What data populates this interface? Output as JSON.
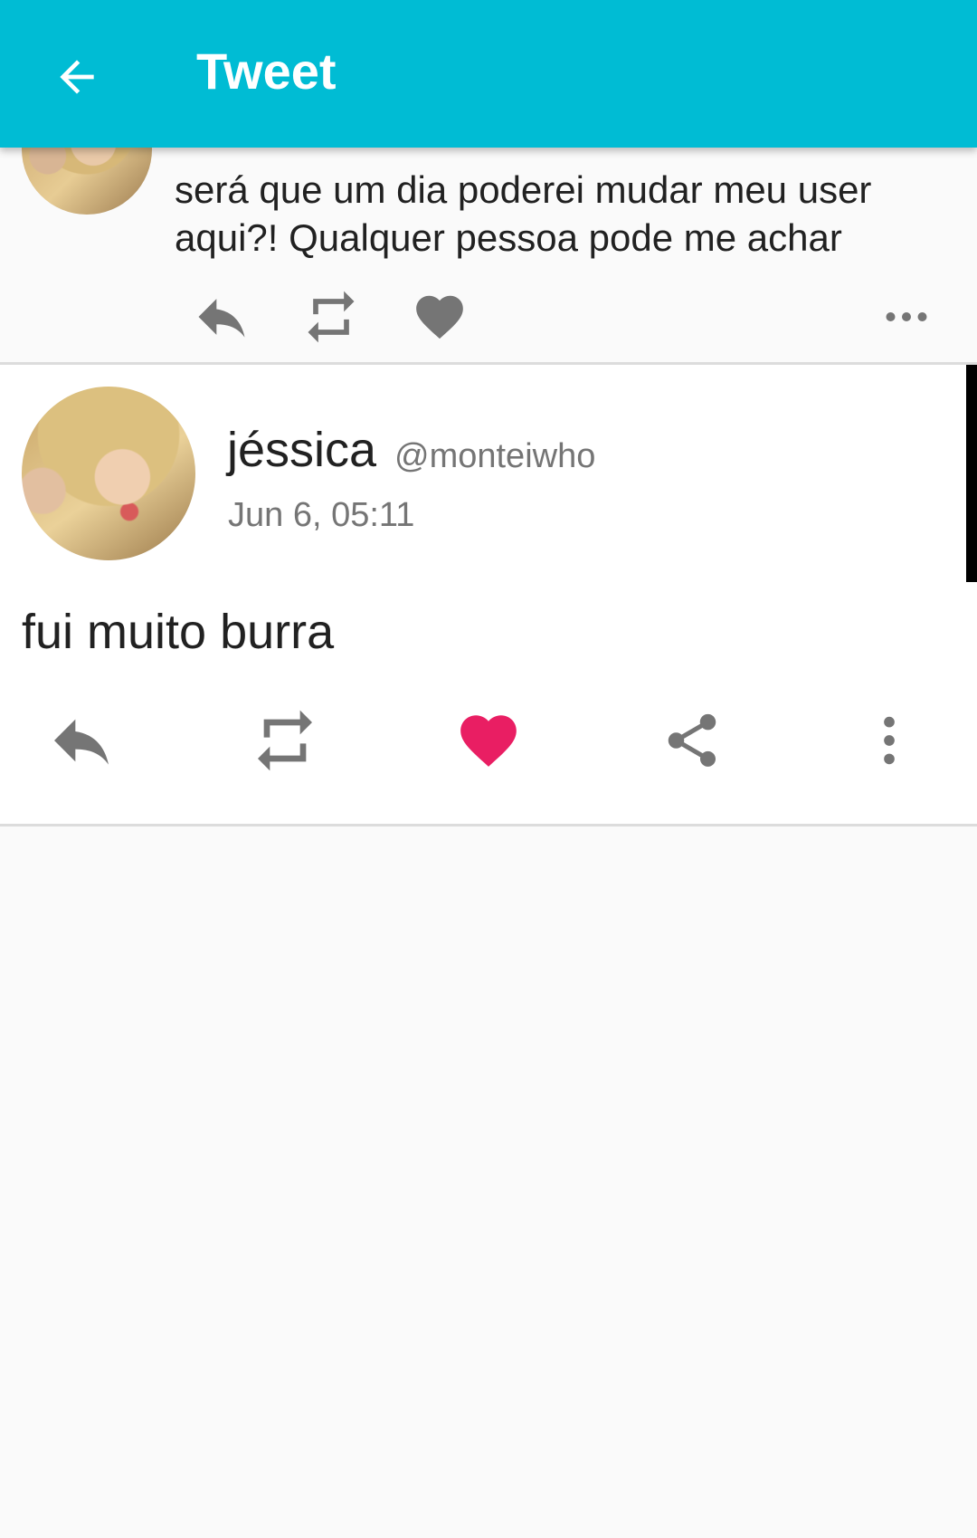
{
  "app_bar": {
    "title": "Tweet",
    "back_icon": "arrow-back-icon",
    "background": "#00bcd4"
  },
  "parent_tweet": {
    "text": "será que um dia poderei mudar meu user aqui?! Qualquer pessoa pode me achar",
    "actions": [
      "reply-icon",
      "retweet-icon",
      "like-icon",
      "more-horiz-icon"
    ]
  },
  "main_tweet": {
    "display_name": "jéssica",
    "handle": "@monteiwho",
    "timestamp": "Jun 6, 05:11",
    "text": "fui muito burra",
    "liked": true,
    "like_color": "#e91e63",
    "actions": [
      "reply-icon",
      "retweet-icon",
      "like-icon",
      "share-icon",
      "more-vert-icon"
    ]
  }
}
